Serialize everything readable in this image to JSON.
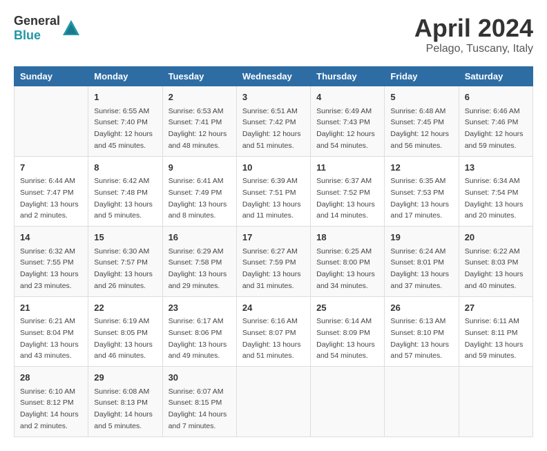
{
  "header": {
    "logo_general": "General",
    "logo_blue": "Blue",
    "month": "April 2024",
    "location": "Pelago, Tuscany, Italy"
  },
  "days_of_week": [
    "Sunday",
    "Monday",
    "Tuesday",
    "Wednesday",
    "Thursday",
    "Friday",
    "Saturday"
  ],
  "weeks": [
    [
      {
        "day": "",
        "info": ""
      },
      {
        "day": "1",
        "info": "Sunrise: 6:55 AM\nSunset: 7:40 PM\nDaylight: 12 hours\nand 45 minutes."
      },
      {
        "day": "2",
        "info": "Sunrise: 6:53 AM\nSunset: 7:41 PM\nDaylight: 12 hours\nand 48 minutes."
      },
      {
        "day": "3",
        "info": "Sunrise: 6:51 AM\nSunset: 7:42 PM\nDaylight: 12 hours\nand 51 minutes."
      },
      {
        "day": "4",
        "info": "Sunrise: 6:49 AM\nSunset: 7:43 PM\nDaylight: 12 hours\nand 54 minutes."
      },
      {
        "day": "5",
        "info": "Sunrise: 6:48 AM\nSunset: 7:45 PM\nDaylight: 12 hours\nand 56 minutes."
      },
      {
        "day": "6",
        "info": "Sunrise: 6:46 AM\nSunset: 7:46 PM\nDaylight: 12 hours\nand 59 minutes."
      }
    ],
    [
      {
        "day": "7",
        "info": "Sunrise: 6:44 AM\nSunset: 7:47 PM\nDaylight: 13 hours\nand 2 minutes."
      },
      {
        "day": "8",
        "info": "Sunrise: 6:42 AM\nSunset: 7:48 PM\nDaylight: 13 hours\nand 5 minutes."
      },
      {
        "day": "9",
        "info": "Sunrise: 6:41 AM\nSunset: 7:49 PM\nDaylight: 13 hours\nand 8 minutes."
      },
      {
        "day": "10",
        "info": "Sunrise: 6:39 AM\nSunset: 7:51 PM\nDaylight: 13 hours\nand 11 minutes."
      },
      {
        "day": "11",
        "info": "Sunrise: 6:37 AM\nSunset: 7:52 PM\nDaylight: 13 hours\nand 14 minutes."
      },
      {
        "day": "12",
        "info": "Sunrise: 6:35 AM\nSunset: 7:53 PM\nDaylight: 13 hours\nand 17 minutes."
      },
      {
        "day": "13",
        "info": "Sunrise: 6:34 AM\nSunset: 7:54 PM\nDaylight: 13 hours\nand 20 minutes."
      }
    ],
    [
      {
        "day": "14",
        "info": "Sunrise: 6:32 AM\nSunset: 7:55 PM\nDaylight: 13 hours\nand 23 minutes."
      },
      {
        "day": "15",
        "info": "Sunrise: 6:30 AM\nSunset: 7:57 PM\nDaylight: 13 hours\nand 26 minutes."
      },
      {
        "day": "16",
        "info": "Sunrise: 6:29 AM\nSunset: 7:58 PM\nDaylight: 13 hours\nand 29 minutes."
      },
      {
        "day": "17",
        "info": "Sunrise: 6:27 AM\nSunset: 7:59 PM\nDaylight: 13 hours\nand 31 minutes."
      },
      {
        "day": "18",
        "info": "Sunrise: 6:25 AM\nSunset: 8:00 PM\nDaylight: 13 hours\nand 34 minutes."
      },
      {
        "day": "19",
        "info": "Sunrise: 6:24 AM\nSunset: 8:01 PM\nDaylight: 13 hours\nand 37 minutes."
      },
      {
        "day": "20",
        "info": "Sunrise: 6:22 AM\nSunset: 8:03 PM\nDaylight: 13 hours\nand 40 minutes."
      }
    ],
    [
      {
        "day": "21",
        "info": "Sunrise: 6:21 AM\nSunset: 8:04 PM\nDaylight: 13 hours\nand 43 minutes."
      },
      {
        "day": "22",
        "info": "Sunrise: 6:19 AM\nSunset: 8:05 PM\nDaylight: 13 hours\nand 46 minutes."
      },
      {
        "day": "23",
        "info": "Sunrise: 6:17 AM\nSunset: 8:06 PM\nDaylight: 13 hours\nand 49 minutes."
      },
      {
        "day": "24",
        "info": "Sunrise: 6:16 AM\nSunset: 8:07 PM\nDaylight: 13 hours\nand 51 minutes."
      },
      {
        "day": "25",
        "info": "Sunrise: 6:14 AM\nSunset: 8:09 PM\nDaylight: 13 hours\nand 54 minutes."
      },
      {
        "day": "26",
        "info": "Sunrise: 6:13 AM\nSunset: 8:10 PM\nDaylight: 13 hours\nand 57 minutes."
      },
      {
        "day": "27",
        "info": "Sunrise: 6:11 AM\nSunset: 8:11 PM\nDaylight: 13 hours\nand 59 minutes."
      }
    ],
    [
      {
        "day": "28",
        "info": "Sunrise: 6:10 AM\nSunset: 8:12 PM\nDaylight: 14 hours\nand 2 minutes."
      },
      {
        "day": "29",
        "info": "Sunrise: 6:08 AM\nSunset: 8:13 PM\nDaylight: 14 hours\nand 5 minutes."
      },
      {
        "day": "30",
        "info": "Sunrise: 6:07 AM\nSunset: 8:15 PM\nDaylight: 14 hours\nand 7 minutes."
      },
      {
        "day": "",
        "info": ""
      },
      {
        "day": "",
        "info": ""
      },
      {
        "day": "",
        "info": ""
      },
      {
        "day": "",
        "info": ""
      }
    ]
  ]
}
